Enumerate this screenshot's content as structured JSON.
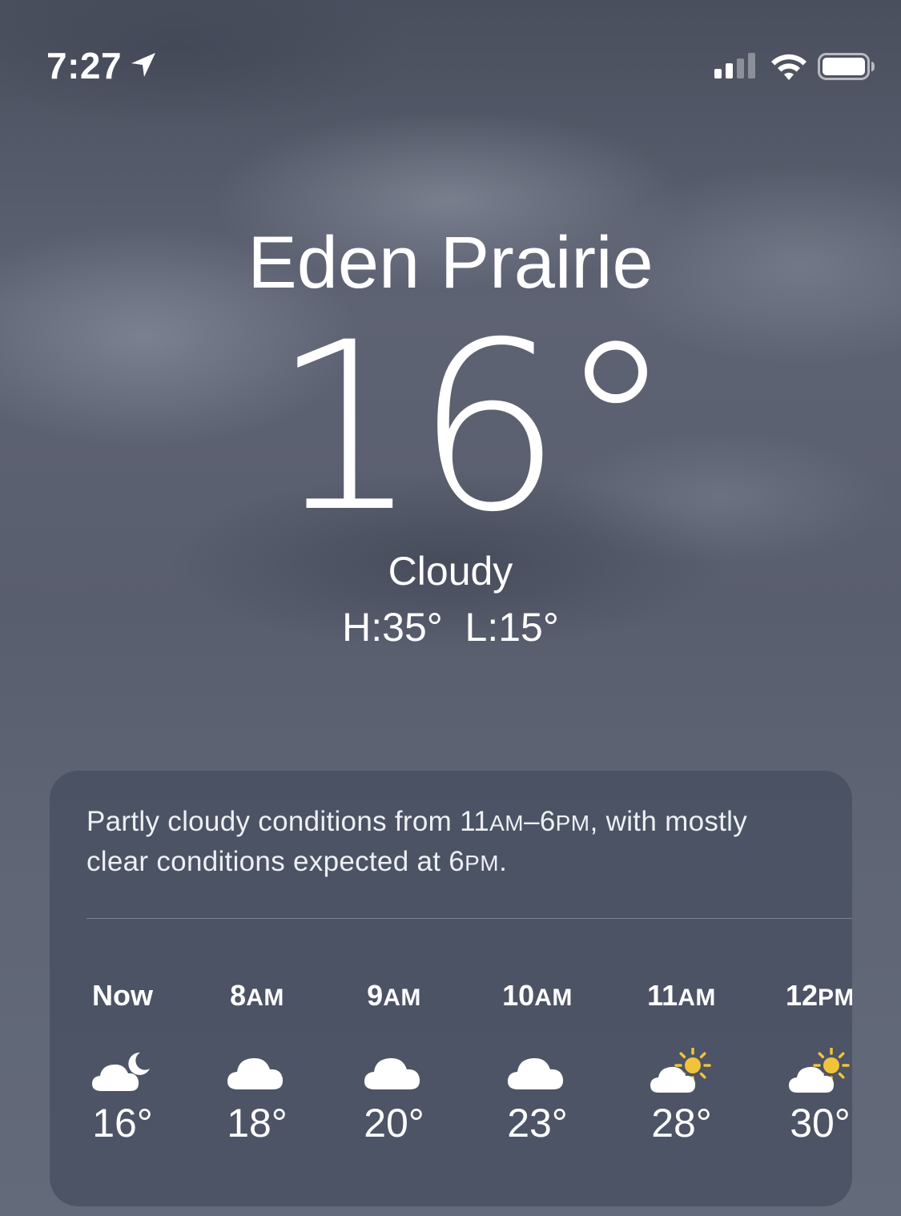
{
  "status_bar": {
    "time": "7:27",
    "location_icon": "location-arrow-icon",
    "signal_icon": "cellular-signal-icon",
    "wifi_icon": "wifi-icon",
    "battery_icon": "battery-full-icon"
  },
  "location": {
    "city": "Eden Prairie",
    "temperature": "16°",
    "condition": "Cloudy",
    "high_low": "H:35°  L:15°"
  },
  "forecast_card": {
    "summary_parts": [
      {
        "text": "Partly cloudy conditions from 11",
        "small": false
      },
      {
        "text": "AM",
        "small": true
      },
      {
        "text": "–6",
        "small": false
      },
      {
        "text": "PM",
        "small": true
      },
      {
        "text": ", with mostly clear conditions expected at 6",
        "small": false
      },
      {
        "text": "PM",
        "small": true
      },
      {
        "text": ".",
        "small": false
      }
    ],
    "hours": [
      {
        "time": "Now",
        "suffix": "",
        "icon": "partly-cloudy-night-icon",
        "temp": "16°"
      },
      {
        "time": "8",
        "suffix": "AM",
        "icon": "cloud-icon",
        "temp": "18°"
      },
      {
        "time": "9",
        "suffix": "AM",
        "icon": "cloud-icon",
        "temp": "20°"
      },
      {
        "time": "10",
        "suffix": "AM",
        "icon": "cloud-icon",
        "temp": "23°"
      },
      {
        "time": "11",
        "suffix": "AM",
        "icon": "partly-cloudy-day-icon",
        "temp": "28°"
      },
      {
        "time": "12",
        "suffix": "PM",
        "icon": "partly-cloudy-day-icon",
        "temp": "30°"
      }
    ]
  },
  "colors": {
    "sun": "#f2c33a",
    "text": "#ffffff",
    "card_background": "#444c5e"
  }
}
